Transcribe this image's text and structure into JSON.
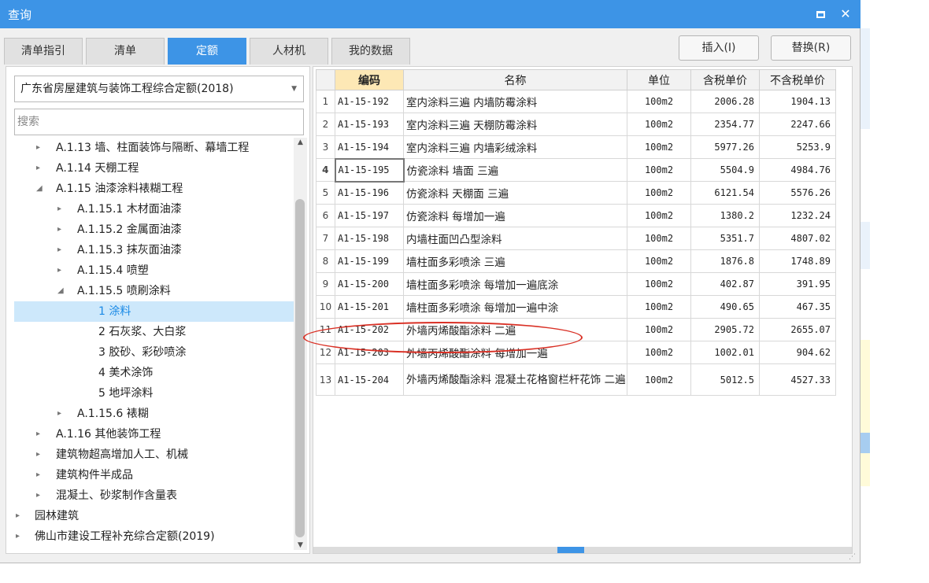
{
  "window": {
    "title": "查询",
    "max_icon": "maximize-icon",
    "close_glyph": "✕"
  },
  "tabs": [
    {
      "label": "清单指引",
      "active": false
    },
    {
      "label": "清单",
      "active": false
    },
    {
      "label": "定额",
      "active": true
    },
    {
      "label": "人材机",
      "active": false
    },
    {
      "label": "我的数据",
      "active": false
    }
  ],
  "toolbar": {
    "insert_label": "插入(I)",
    "replace_label": "替换(R)"
  },
  "library": {
    "selected": "广东省房屋建筑与装饰工程综合定额(2018)"
  },
  "search": {
    "placeholder": "搜索"
  },
  "tree": [
    {
      "label": "A.1.13 墙、柱面装饰与隔断、幕墙工程",
      "level": 1,
      "caret": "▸",
      "selected": false
    },
    {
      "label": "A.1.14 天棚工程",
      "level": 1,
      "caret": "▸",
      "selected": false
    },
    {
      "label": "A.1.15 油漆涂料裱糊工程",
      "level": 1,
      "caret": "◢",
      "selected": false
    },
    {
      "label": "A.1.15.1 木材面油漆",
      "level": 2,
      "caret": "▸",
      "selected": false
    },
    {
      "label": "A.1.15.2 金属面油漆",
      "level": 2,
      "caret": "▸",
      "selected": false
    },
    {
      "label": "A.1.15.3 抹灰面油漆",
      "level": 2,
      "caret": "▸",
      "selected": false
    },
    {
      "label": "A.1.15.4 喷塑",
      "level": 2,
      "caret": "▸",
      "selected": false
    },
    {
      "label": "A.1.15.5 喷刷涂料",
      "level": 2,
      "caret": "◢",
      "selected": false
    },
    {
      "label": "1 涂料",
      "level": 3,
      "caret": "",
      "selected": true
    },
    {
      "label": "2 石灰浆、大白浆",
      "level": 3,
      "caret": "",
      "selected": false
    },
    {
      "label": "3 胶砂、彩砂喷涂",
      "level": 3,
      "caret": "",
      "selected": false
    },
    {
      "label": "4 美术涂饰",
      "level": 3,
      "caret": "",
      "selected": false
    },
    {
      "label": "5 地坪涂料",
      "level": 3,
      "caret": "",
      "selected": false
    },
    {
      "label": "A.1.15.6 裱糊",
      "level": 2,
      "caret": "▸",
      "selected": false
    },
    {
      "label": "A.1.16 其他装饰工程",
      "level": 1,
      "caret": "▸",
      "selected": false
    },
    {
      "label": "建筑物超高增加人工、机械",
      "level": 1,
      "caret": "▸",
      "selected": false
    },
    {
      "label": "建筑构件半成品",
      "level": 1,
      "caret": "▸",
      "selected": false
    },
    {
      "label": "混凝土、砂浆制作含量表",
      "level": 1,
      "caret": "▸",
      "selected": false
    },
    {
      "label": "园林建筑",
      "level": 0,
      "caret": "▸",
      "selected": false
    },
    {
      "label": "佛山市建设工程补充综合定额(2019)",
      "level": 0,
      "caret": "▸",
      "selected": false
    }
  ],
  "grid": {
    "headers": {
      "num": "",
      "code": "编码",
      "name": "名称",
      "unit": "单位",
      "tax_price": "含税单价",
      "notax_price": "不含税单价"
    },
    "current_row": 4,
    "rows": [
      {
        "num": "1",
        "code": "A1-15-192",
        "name": "室内涂料三遍 内墙防霉涂料",
        "unit": "100m2",
        "tax_price": "2006.28",
        "notax_price": "1904.13"
      },
      {
        "num": "2",
        "code": "A1-15-193",
        "name": "室内涂料三遍 天棚防霉涂料",
        "unit": "100m2",
        "tax_price": "2354.77",
        "notax_price": "2247.66"
      },
      {
        "num": "3",
        "code": "A1-15-194",
        "name": "室内涂料三遍 内墙彩绒涂料",
        "unit": "100m2",
        "tax_price": "5977.26",
        "notax_price": "5253.9"
      },
      {
        "num": "4",
        "code": "A1-15-195",
        "name": "仿瓷涂料 墙面 三遍",
        "unit": "100m2",
        "tax_price": "5504.9",
        "notax_price": "4984.76"
      },
      {
        "num": "5",
        "code": "A1-15-196",
        "name": "仿瓷涂料 天棚面 三遍",
        "unit": "100m2",
        "tax_price": "6121.54",
        "notax_price": "5576.26"
      },
      {
        "num": "6",
        "code": "A1-15-197",
        "name": "仿瓷涂料 每增加一遍",
        "unit": "100m2",
        "tax_price": "1380.2",
        "notax_price": "1232.24"
      },
      {
        "num": "7",
        "code": "A1-15-198",
        "name": "内墙柱面凹凸型涂料",
        "unit": "100m2",
        "tax_price": "5351.7",
        "notax_price": "4807.02"
      },
      {
        "num": "8",
        "code": "A1-15-199",
        "name": "墙柱面多彩喷涂 三遍",
        "unit": "100m2",
        "tax_price": "1876.8",
        "notax_price": "1748.89"
      },
      {
        "num": "9",
        "code": "A1-15-200",
        "name": "墙柱面多彩喷涂 每增加一遍底涂",
        "unit": "100m2",
        "tax_price": "402.87",
        "notax_price": "391.95"
      },
      {
        "num": "10",
        "code": "A1-15-201",
        "name": "墙柱面多彩喷涂 每增加一遍中涂",
        "unit": "100m2",
        "tax_price": "490.65",
        "notax_price": "467.35"
      },
      {
        "num": "11",
        "code": "A1-15-202",
        "name": "外墙丙烯酸酯涂料 二遍",
        "unit": "100m2",
        "tax_price": "2905.72",
        "notax_price": "2655.07"
      },
      {
        "num": "12",
        "code": "A1-15-203",
        "name": "外墙丙烯酸酯涂料 每增加一遍",
        "unit": "100m2",
        "tax_price": "1002.01",
        "notax_price": "904.62"
      },
      {
        "num": "13",
        "code": "A1-15-204",
        "name": "外墙丙烯酸酯涂料 混凝土花格窗栏杆花饰 二遍",
        "unit": "100m2",
        "tax_price": "5012.5",
        "notax_price": "4527.33"
      }
    ]
  },
  "colors": {
    "accent": "#3d94e6",
    "selected_bg": "#cde8fb",
    "header_highlight": "#fde8b5",
    "annotation": "#d93025"
  }
}
